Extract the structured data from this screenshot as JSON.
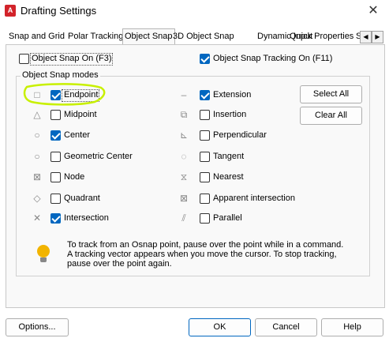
{
  "window": {
    "app_icon": "A",
    "title": "Drafting Settings",
    "close_glyph": "✕"
  },
  "tabs": [
    {
      "label": "Snap and Grid"
    },
    {
      "label": "Polar Tracking"
    },
    {
      "label": "Object Snap"
    },
    {
      "label": "3D Object Snap"
    },
    {
      "label": "Dynamic Input"
    },
    {
      "label": "Quick Properties"
    },
    {
      "label": "S"
    }
  ],
  "tab_scroll": {
    "left": "◀",
    "right": "▶"
  },
  "top_options": {
    "osnap_on": {
      "label": "Object Snap On (F3)",
      "checked": false
    },
    "tracking_on": {
      "label": "Object Snap Tracking On (F11)",
      "checked": true
    }
  },
  "modes_title": "Object Snap modes",
  "left_modes": [
    {
      "label": "Endpoint",
      "checked": true,
      "icon": "endpoint-icon",
      "glyph": "□"
    },
    {
      "label": "Midpoint",
      "checked": false,
      "icon": "midpoint-icon",
      "glyph": "△"
    },
    {
      "label": "Center",
      "checked": true,
      "icon": "center-icon",
      "glyph": "○"
    },
    {
      "label": "Geometric Center",
      "checked": false,
      "icon": "geometric-center-icon",
      "glyph": "○"
    },
    {
      "label": "Node",
      "checked": false,
      "icon": "node-icon",
      "glyph": "⊠"
    },
    {
      "label": "Quadrant",
      "checked": false,
      "icon": "quadrant-icon",
      "glyph": "◇"
    },
    {
      "label": "Intersection",
      "checked": true,
      "icon": "intersection-icon",
      "glyph": "✕"
    }
  ],
  "right_modes": [
    {
      "label": "Extension",
      "checked": true,
      "icon": "extension-icon",
      "glyph": "–"
    },
    {
      "label": "Insertion",
      "checked": false,
      "icon": "insertion-icon",
      "glyph": "⧉"
    },
    {
      "label": "Perpendicular",
      "checked": false,
      "icon": "perpendicular-icon",
      "glyph": "⊾"
    },
    {
      "label": "Tangent",
      "checked": false,
      "icon": "tangent-icon",
      "glyph": "◌"
    },
    {
      "label": "Nearest",
      "checked": false,
      "icon": "nearest-icon",
      "glyph": "⧖"
    },
    {
      "label": "Apparent intersection",
      "checked": false,
      "icon": "apparent-intersection-icon",
      "glyph": "⊠"
    },
    {
      "label": "Parallel",
      "checked": false,
      "icon": "parallel-icon",
      "glyph": "⫽"
    }
  ],
  "buttons": {
    "select_all": "Select All",
    "clear_all": "Clear All",
    "options": "Options...",
    "ok": "OK",
    "cancel": "Cancel",
    "help": "Help"
  },
  "tip": [
    "To track from an Osnap point, pause over the point while in a command.",
    " A tracking vector appears when you move the cursor.  To stop tracking,",
    "pause over the point again."
  ],
  "colors": {
    "accent": "#0067c0",
    "highlight": "#c8f000"
  }
}
